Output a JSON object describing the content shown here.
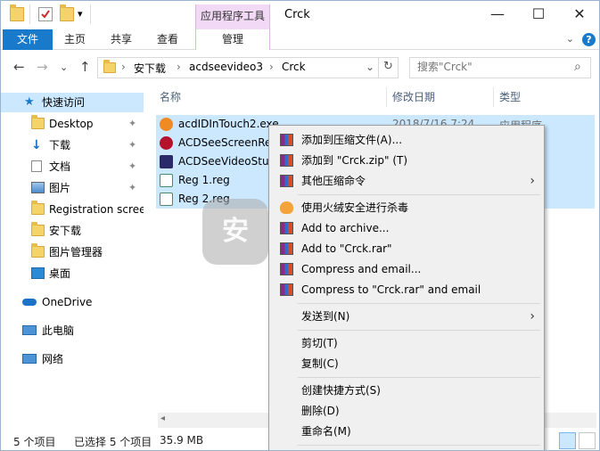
{
  "titlebar": {
    "title": "Crck",
    "context_tab_header": "应用程序工具",
    "minimize_glyph": "—",
    "maximize_glyph": "☐",
    "close_glyph": "✕",
    "qat_dropdown_glyph": "▾"
  },
  "ribbon": {
    "tabs": [
      "文件",
      "主页",
      "共享",
      "查看",
      "管理"
    ],
    "expand_glyph": "⌄",
    "help_glyph": "?"
  },
  "nav": {
    "back_glyph": "←",
    "forward_glyph": "→",
    "recent_glyph": "⌄",
    "up_glyph": "↑",
    "breadcrumb": [
      "安下载",
      "acdseevideo3",
      "Crck"
    ],
    "breadcrumb_sep": "›",
    "address_dropdown_glyph": "⌄",
    "refresh_glyph": "↻",
    "search_placeholder": "搜索\"Crck\"",
    "search_icon_glyph": "⌕"
  },
  "sidebar": {
    "quick_access": "快速访问",
    "items": [
      {
        "label": "Desktop",
        "pinned": true
      },
      {
        "label": "下载",
        "pinned": true
      },
      {
        "label": "文档",
        "pinned": true
      },
      {
        "label": "图片",
        "pinned": true
      },
      {
        "label": "Registration scree",
        "pinned": false
      },
      {
        "label": "安下载",
        "pinned": false
      },
      {
        "label": "图片管理器",
        "pinned": false
      },
      {
        "label": "桌面",
        "pinned": false
      }
    ],
    "pin_glyph": "📌",
    "onedrive": "OneDrive",
    "this_pc": "此电脑",
    "network": "网络"
  },
  "filelist": {
    "columns": [
      "名称",
      "修改日期",
      "类型"
    ],
    "files": [
      {
        "name": "acdIDInTouch2.exe",
        "date": "2018/7/16 7:24",
        "type": "应用程序"
      },
      {
        "name": "ACDSeeScreenRec"
      },
      {
        "name": "ACDSeeVideoStud"
      },
      {
        "name": "Reg 1.reg"
      },
      {
        "name": "Reg 2.reg"
      }
    ]
  },
  "watermark": "安",
  "context_menu": {
    "items": [
      {
        "label": "添加到压缩文件(A)...",
        "icon": "rar-icon"
      },
      {
        "label": "添加到 \"Crck.zip\" (T)",
        "icon": "rar-icon"
      },
      {
        "label": "其他压缩命令",
        "icon": "rar-icon",
        "submenu": true
      },
      {
        "label": "使用火绒安全进行杀毒",
        "icon": "huorong-icon"
      },
      {
        "label": "Add to archive...",
        "icon": "winrar-icon"
      },
      {
        "label": "Add to \"Crck.rar\"",
        "icon": "winrar-icon"
      },
      {
        "label": "Compress and email...",
        "icon": "winrar-icon"
      },
      {
        "label": "Compress to \"Crck.rar\" and email",
        "icon": "winrar-icon"
      },
      {
        "label": "发送到(N)",
        "submenu": true
      },
      {
        "label": "剪切(T)"
      },
      {
        "label": "复制(C)"
      },
      {
        "label": "创建快捷方式(S)"
      },
      {
        "label": "删除(D)"
      },
      {
        "label": "重命名(M)"
      }
    ],
    "submenu_glyph": "›"
  },
  "statusbar": {
    "count": "5 个项目",
    "selected": "已选择 5 个项目",
    "size": "35.9 MB"
  },
  "colors": {
    "accent": "#1979ca",
    "selection": "#cce8ff",
    "context_tab": "#f2d9f5"
  }
}
